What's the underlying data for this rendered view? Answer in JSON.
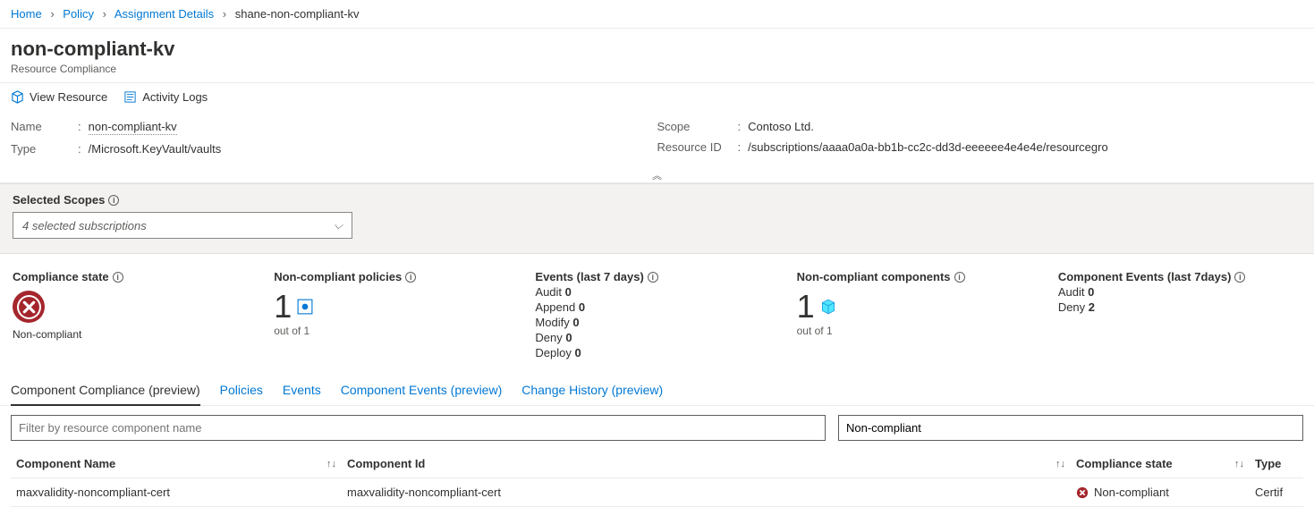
{
  "breadcrumb": {
    "items": [
      "Home",
      "Policy",
      "Assignment Details"
    ],
    "current": "shane-non-compliant-kv"
  },
  "header": {
    "title": "non-compliant-kv",
    "subtitle": "Resource Compliance"
  },
  "toolbar": {
    "view_resource": "View Resource",
    "activity_logs": "Activity Logs"
  },
  "properties": {
    "left": {
      "name_label": "Name",
      "name_value": "non-compliant-kv",
      "type_label": "Type",
      "type_value": "/Microsoft.KeyVault/vaults"
    },
    "right": {
      "scope_label": "Scope",
      "scope_value": "Contoso Ltd.",
      "resid_label": "Resource ID",
      "resid_value": "/subscriptions/aaaa0a0a-bb1b-cc2c-dd3d-eeeeee4e4e4e/resourcegro"
    }
  },
  "scopes": {
    "label": "Selected Scopes",
    "selected": "4 selected subscriptions"
  },
  "stats": {
    "compliance": {
      "title": "Compliance state",
      "status": "Non-compliant"
    },
    "noncompliant_policies": {
      "title": "Non-compliant policies",
      "value": "1",
      "sub": "out of 1"
    },
    "events": {
      "title": "Events (last 7 days)",
      "rows": {
        "audit_l": "Audit",
        "audit_v": "0",
        "append_l": "Append",
        "append_v": "0",
        "modify_l": "Modify",
        "modify_v": "0",
        "deny_l": "Deny",
        "deny_v": "0",
        "deploy_l": "Deploy",
        "deploy_v": "0"
      }
    },
    "noncompliant_components": {
      "title": "Non-compliant components",
      "value": "1",
      "sub": "out of 1"
    },
    "component_events": {
      "title": "Component Events (last 7days)",
      "rows": {
        "audit_l": "Audit",
        "audit_v": "0",
        "deny_l": "Deny",
        "deny_v": "2"
      }
    }
  },
  "tabs": {
    "component_compliance": "Component Compliance (preview)",
    "policies": "Policies",
    "events": "Events",
    "component_events": "Component Events (preview)",
    "change_history": "Change History (preview)"
  },
  "filters": {
    "name_placeholder": "Filter by resource component name",
    "state_value": "Non-compliant"
  },
  "grid": {
    "headers": {
      "name": "Component Name",
      "id": "Component Id",
      "state": "Compliance state",
      "type": "Type"
    },
    "row": {
      "name": "maxvalidity-noncompliant-cert",
      "id": "maxvalidity-noncompliant-cert",
      "state": "Non-compliant",
      "type": "Certif"
    }
  }
}
